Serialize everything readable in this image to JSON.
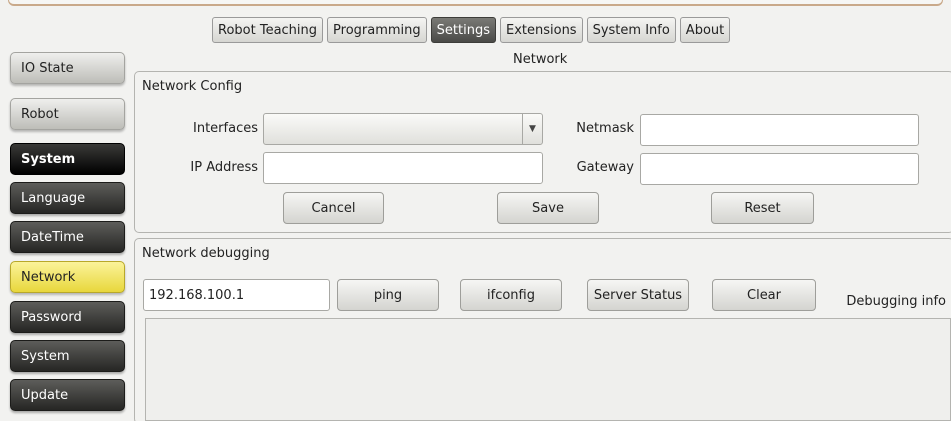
{
  "top_tabs": [
    {
      "label": "Robot Teaching",
      "active": false
    },
    {
      "label": "Programming",
      "active": false
    },
    {
      "label": "Settings",
      "active": true
    },
    {
      "label": "Extensions",
      "active": false
    },
    {
      "label": "System Info",
      "active": false
    },
    {
      "label": "About",
      "active": false
    }
  ],
  "page_title": "Network",
  "sidebar": {
    "items": [
      {
        "label": "IO State"
      },
      {
        "label": "Robot"
      },
      {
        "label": "System"
      },
      {
        "label": "Language"
      },
      {
        "label": "DateTime"
      },
      {
        "label": "Network"
      },
      {
        "label": "Password"
      },
      {
        "label": "System"
      },
      {
        "label": "Update"
      }
    ]
  },
  "network_config": {
    "title": "Network Config",
    "interfaces_label": "Interfaces",
    "interfaces_value": "",
    "netmask_label": "Netmask",
    "netmask_value": "",
    "ip_label": "IP Address",
    "ip_value": "",
    "gateway_label": "Gateway",
    "gateway_value": "",
    "cancel_label": "Cancel",
    "save_label": "Save",
    "reset_label": "Reset"
  },
  "network_debugging": {
    "title": "Network debugging",
    "host_value": "192.168.100.1",
    "ping_label": "ping",
    "ifconfig_label": "ifconfig",
    "server_status_label": "Server Status",
    "clear_label": "Clear",
    "info_label": "Debugging info",
    "output": ""
  },
  "colors": {
    "active_tab": "#4a4a47",
    "selected_sidebar": "#e8d73c",
    "dark_button": "#262624"
  }
}
